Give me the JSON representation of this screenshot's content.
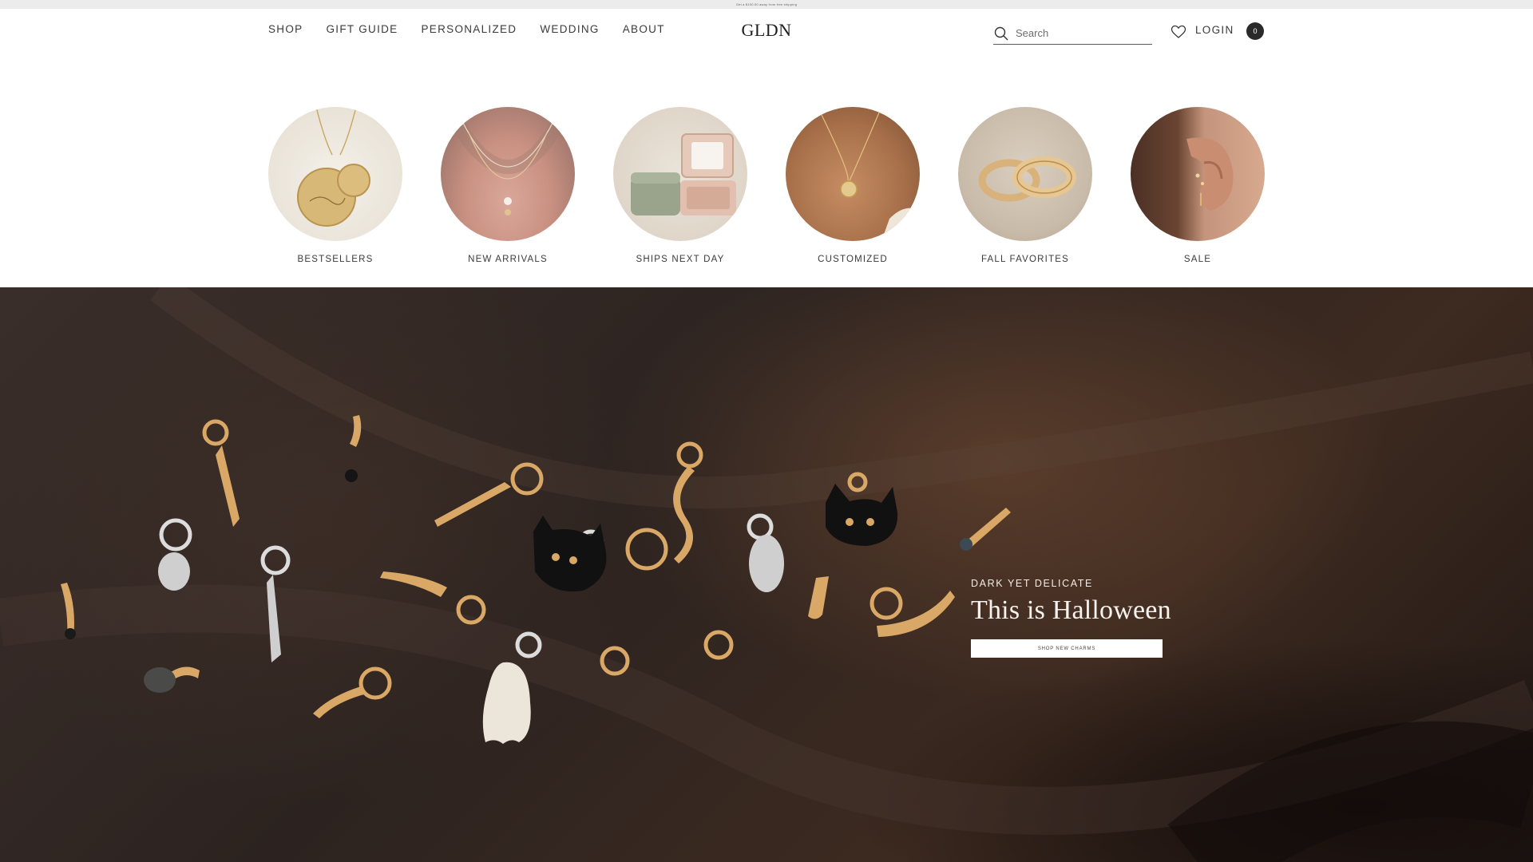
{
  "announcement": {
    "text": "Get a $100.00 away from free shipping"
  },
  "header": {
    "nav": [
      "SHOP",
      "GIFT GUIDE",
      "PERSONALIZED",
      "WEDDING",
      "ABOUT"
    ],
    "logo": "GLDN",
    "search": {
      "placeholder": "Search",
      "value": ""
    },
    "login_label": "LOGIN",
    "cart_count": "0",
    "icons": {
      "search": "search-icon",
      "wishlist": "heart-icon",
      "cart": "cart-badge"
    }
  },
  "categories": [
    {
      "label": "BESTSELLERS",
      "image": "gold-disc-necklaces-photo"
    },
    {
      "label": "NEW ARRIVALS",
      "image": "layered-necklace-model-photo"
    },
    {
      "label": "SHIPS NEXT DAY",
      "image": "jewelry-box-photo"
    },
    {
      "label": "CUSTOMIZED",
      "image": "coin-pendant-model-photo"
    },
    {
      "label": "FALL FAVORITES",
      "image": "gold-rings-photo"
    },
    {
      "label": "SALE",
      "image": "ear-studs-model-photo"
    }
  ],
  "hero": {
    "eyebrow": "DARK YET DELICATE",
    "headline": "This is Halloween",
    "cta_label": "SHOP NEW CHARMS",
    "image": "halloween-charms-on-dark-satin-photo"
  },
  "colors": {
    "accent": "#2a2a2a",
    "hero_text": "#f7f2ee",
    "announce_bg": "#ececec"
  }
}
